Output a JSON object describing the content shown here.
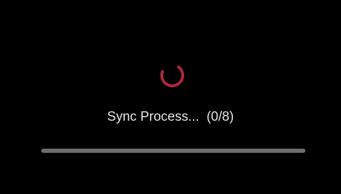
{
  "colors": {
    "background": "#000000",
    "spinner": "#b0283f",
    "text": "#e6e6e6",
    "progress_track": "#6d6d6d",
    "progress_fill": "#a82a40"
  },
  "spinner": {
    "icon": "loading-spinner-icon"
  },
  "sync": {
    "status_text": "Sync Process...",
    "count_text": "(0/8)"
  },
  "progress": {
    "completed": 0,
    "total": 8,
    "fraction": 0
  }
}
